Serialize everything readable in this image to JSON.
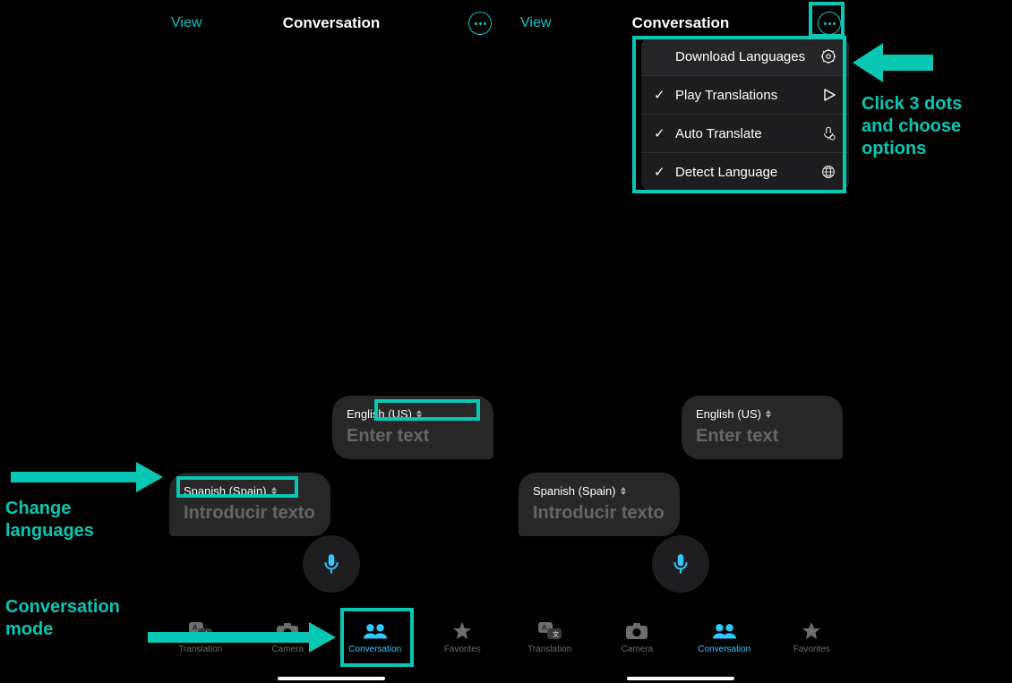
{
  "topbar": {
    "view": "View",
    "title": "Conversation"
  },
  "bubbles": {
    "english": {
      "lang": "English (US)",
      "placeholder": "Enter text"
    },
    "spanish": {
      "lang": "Spanish (Spain)",
      "placeholder": "Introducir texto"
    }
  },
  "tabs": {
    "translation": "Translation",
    "camera": "Camera",
    "conversation": "Conversation",
    "favorites": "Favorites"
  },
  "menu": {
    "download": "Download Languages",
    "play": "Play Translations",
    "auto": "Auto Translate",
    "detect": "Detect Language"
  },
  "annotations": {
    "change_languages": "Change\nlanguages",
    "conversation_mode": "Conversation\nmode",
    "click_dots": "Click 3 dots\nand choose\noptions"
  }
}
